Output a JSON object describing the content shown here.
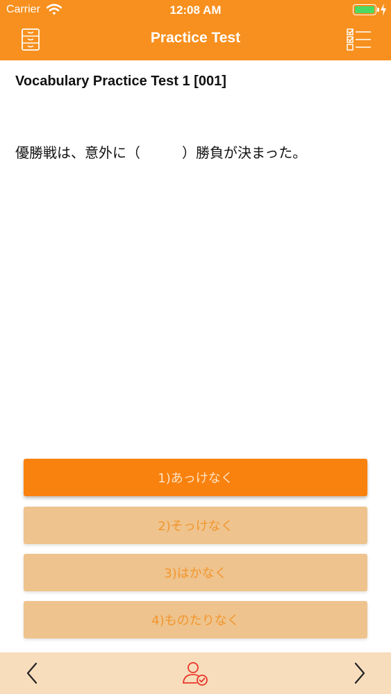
{
  "status_bar": {
    "carrier": "Carrier",
    "time": "12:08 AM",
    "battery_level": 1.0
  },
  "header": {
    "title": "Practice Test",
    "left_icon": "file-cabinet-icon",
    "right_icon": "checklist-icon"
  },
  "test": {
    "title": "Vocabulary Practice Test 1 [001]",
    "question": "優勝戦は、意外に（　　　）勝負が決まった。"
  },
  "answers": [
    {
      "label": "1)あっけなく",
      "selected": true
    },
    {
      "label": "2)そっけなく",
      "selected": false
    },
    {
      "label": "3)はかなく",
      "selected": false
    },
    {
      "label": "4)ものたりなく",
      "selected": false
    }
  ],
  "toolbar": {
    "prev_icon": "chevron-left-icon",
    "middle_icon": "user-check-icon",
    "next_icon": "chevron-right-icon"
  },
  "colors": {
    "accent": "#F7901E",
    "selected_answer": "#F9820F",
    "answer": "#EEC38D",
    "toolbar": "#F8DDBC",
    "icon_red": "#E8352B",
    "battery": "#4CD964"
  }
}
